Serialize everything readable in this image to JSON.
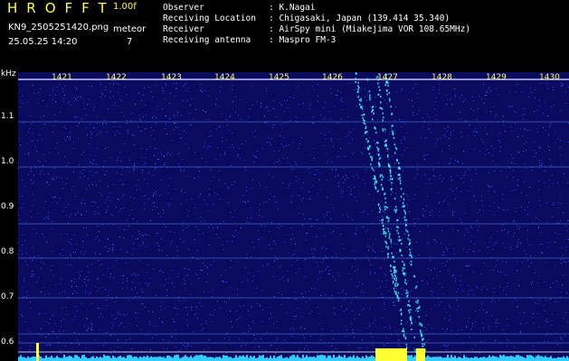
{
  "header": {
    "app_title": "HROFFT",
    "version": "1.00f",
    "file_name": "KN9_2505251420.png",
    "datetime": "25.05.25 14:20",
    "meteor_label": "meteor",
    "meteor_count": "7"
  },
  "info": [
    {
      "key": "Observer",
      "value": ": K.Nagai"
    },
    {
      "key": "Receiving Location",
      "value": ": Chigasaki, Japan (139.414 35.340)"
    },
    {
      "key": "Receiver",
      "value": ": AirSpy mini (Miakejima VOR 108.65MHz)"
    },
    {
      "key": "Receiving antenna",
      "value": ": Maspro FM-3"
    }
  ],
  "axis": {
    "y_unit": "kHz",
    "y_ticks": [
      "1.1",
      "1.0",
      "0.9",
      "0.8",
      "0.7",
      "0.6"
    ],
    "x_ticks": [
      "1421",
      "1422",
      "1423",
      "1424",
      "1425",
      "1426",
      "1427",
      "1428",
      "1429",
      "1430"
    ]
  },
  "colors": {
    "background": "#0a0a5e",
    "signal": "#40ffff",
    "noise": "#2a4aff",
    "label_yellow": "#ffff33"
  }
}
